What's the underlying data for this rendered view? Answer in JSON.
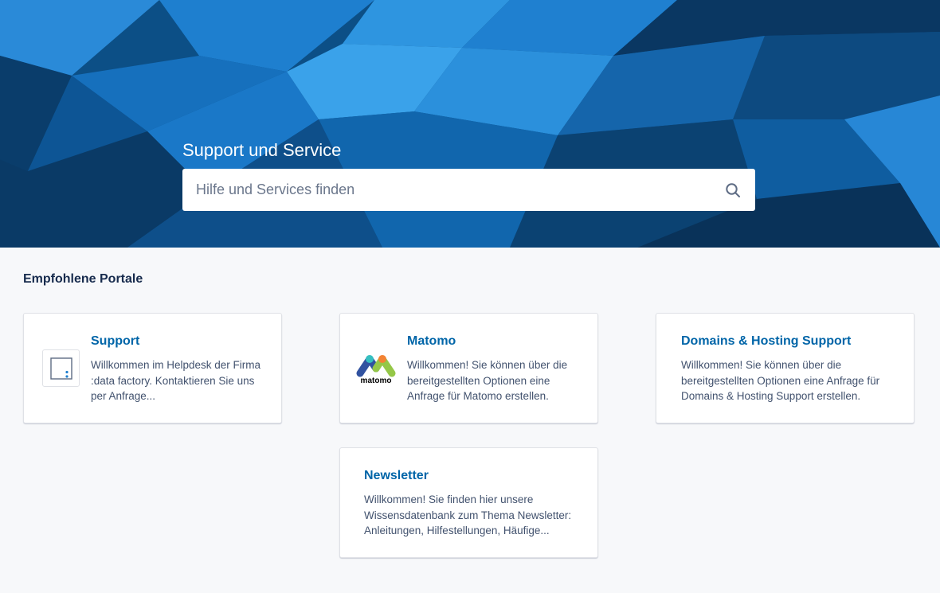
{
  "hero": {
    "title": "Support und Service",
    "search": {
      "placeholder": "Hilfe und Services finden",
      "value": ""
    },
    "background_colors": [
      "#0b3a66",
      "#0f5a99",
      "#1f7fcf",
      "#3aa0e8"
    ]
  },
  "section": {
    "title": "Empfohlene Portale"
  },
  "portals": [
    {
      "title": "Support",
      "description": "Willkommen im Helpdesk der Firma :data factory. Kontaktieren Sie uns per Anfrage...",
      "icon": "data-factory-logo-icon"
    },
    {
      "title": "Matomo",
      "description": "Willkommen! Sie können über die bereitgestellten Optionen eine Anfrage für Matomo erstellen.",
      "icon": "matomo-logo-icon",
      "logo_text": "matomo"
    },
    {
      "title": "Domains & Hosting Support",
      "description": "Willkommen! Sie können über die bereitgestellten Optionen eine Anfrage für Domains & Hosting Support erstellen."
    },
    {
      "title": "Newsletter",
      "description": "Willkommen! Sie finden hier unsere Wissensdatenbank zum Thema Newsletter: Anleitungen, Hilfestellungen, Häufige..."
    }
  ],
  "colors": {
    "accent": "#0065a8",
    "title": "#172b4d",
    "text": "#42526e",
    "page_bg": "#f7f8fa"
  }
}
